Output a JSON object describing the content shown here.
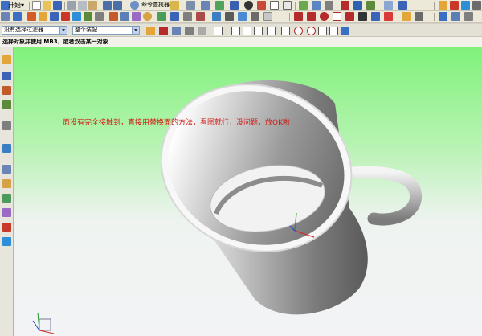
{
  "toolbar": {
    "start_label": "开始▾",
    "command_finder_label": "命令查找器"
  },
  "selection_bar": {
    "filter_value": "没有选择过滤器",
    "scope_value": "整个装配"
  },
  "status": {
    "prompt": "选择对象并使用 MB3，或者双击某一对象"
  },
  "viewport": {
    "note": "面没有完全接触到，直接用替换面的方法，看图就行，没问题，放OK啦",
    "background_top": "#7ff27a",
    "background_bottom": "#f3f3f5",
    "annotation_color": "#d11a12"
  },
  "icons": [
    "new-file-icon",
    "open-icon",
    "save-icon",
    "undo-icon",
    "redo-icon",
    "cut-icon",
    "copy-icon",
    "paste-icon",
    "delete-icon",
    "command-finder-icon",
    "snap-icon",
    "view-orientation-icon",
    "render-style-icon",
    "layer-icon",
    "point-icon",
    "line-icon",
    "arc-icon",
    "rectangle-icon",
    "text-icon",
    "dimension-icon",
    "color-icon",
    "selection-filter-icon",
    "wcs-icon"
  ]
}
